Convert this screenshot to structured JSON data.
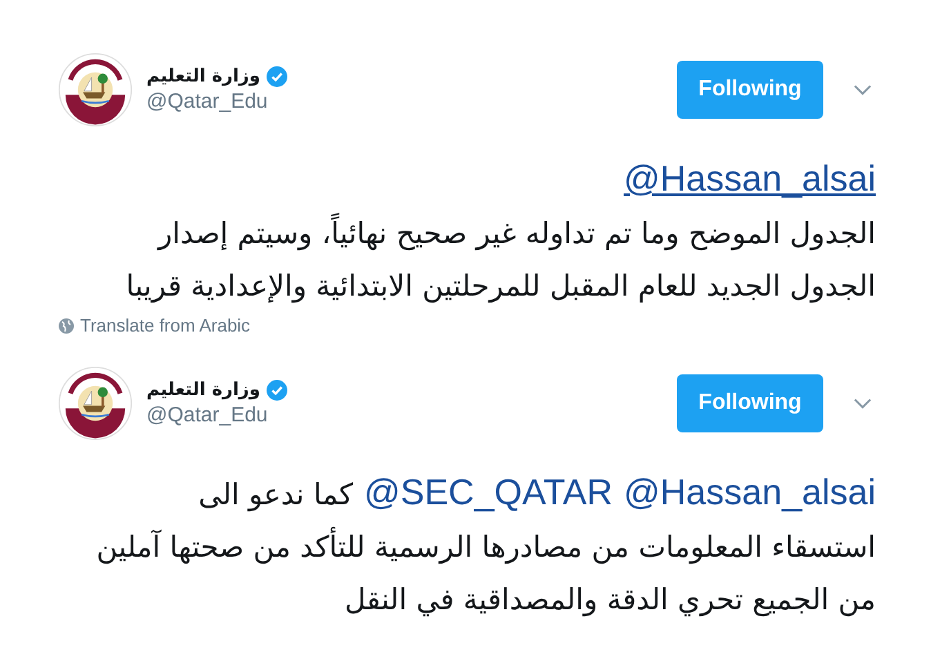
{
  "tweets": [
    {
      "name": "وزارة التعليم",
      "verified": true,
      "handle": "@Qatar_Edu",
      "follow_button": "Following",
      "body": [
        [
          {
            "kind": "mention",
            "text": "@Hassan_alsai"
          }
        ],
        [
          {
            "kind": "text",
            "text": "الجدول الموضح وما تم تداوله غير صحيح نهائياً، وسيتم إصدار"
          }
        ],
        [
          {
            "kind": "text",
            "text": "الجدول الجديد للعام المقبل للمرحلتين الابتدائية والإعدادية قريبا"
          }
        ]
      ],
      "translate": "Translate from Arabic"
    },
    {
      "name": "وزارة التعليم",
      "verified": true,
      "handle": "@Qatar_Edu",
      "follow_button": "Following",
      "body": [
        [
          {
            "kind": "mention",
            "text": "@Hassan_alsai"
          },
          {
            "kind": "mention",
            "text": "@SEC_QATAR"
          },
          {
            "kind": "text",
            "text": "كما ندعو الى"
          }
        ],
        [
          {
            "kind": "text",
            "text": "استسقاء المعلومات من مصادرها الرسمية للتأكد من صحتها آملين"
          }
        ],
        [
          {
            "kind": "text",
            "text": "من الجميع تحري الدقة والمصداقية في النقل"
          }
        ]
      ]
    }
  ]
}
